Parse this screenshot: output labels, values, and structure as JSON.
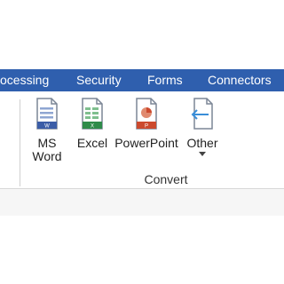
{
  "tabs": [
    {
      "label": "ocessing"
    },
    {
      "label": "Security"
    },
    {
      "label": "Forms"
    },
    {
      "label": "Connectors"
    }
  ],
  "convert_group": {
    "title": "Convert",
    "buttons": [
      {
        "label_line1": "MS",
        "label_line2": "Word",
        "icon": "word-document-icon"
      },
      {
        "label": "Excel",
        "icon": "excel-document-icon"
      },
      {
        "label": "PowerPoint",
        "icon": "powerpoint-document-icon"
      },
      {
        "label": "Other",
        "icon": "other-document-arrow-icon"
      }
    ]
  },
  "colors": {
    "tab_bar": "#2f5fae",
    "word": "#3b5da7",
    "excel": "#2e8b4a",
    "powerpoint": "#cc4a2e",
    "other": "#3a8ed8"
  }
}
